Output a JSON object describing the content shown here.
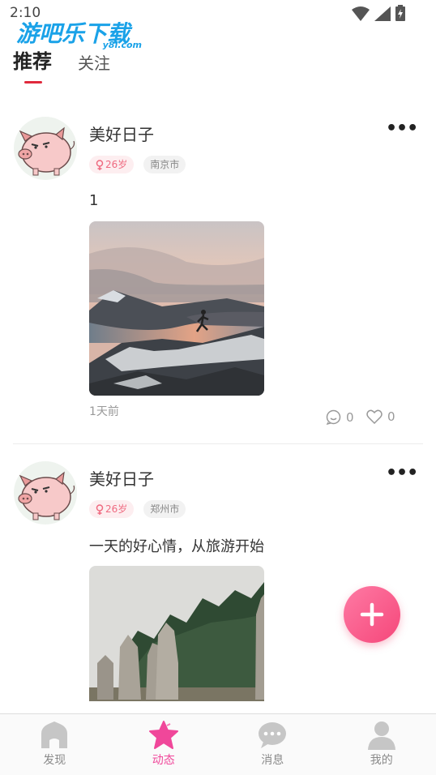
{
  "status_bar": {
    "time": "2:10"
  },
  "watermark": {
    "main": "游吧乐下载",
    "sub": "y8l.com"
  },
  "tabs": [
    {
      "label": "推荐"
    },
    {
      "label": "关注"
    }
  ],
  "posts": [
    {
      "username": "美好日子",
      "age": "26岁",
      "city": "南京市",
      "content": "1",
      "time": "1天前",
      "comments": "0",
      "likes": "0"
    },
    {
      "username": "美好日子",
      "age": "26岁",
      "city": "郑州市",
      "content": "一天的好心情，从旅游开始"
    }
  ],
  "bottom_nav": [
    {
      "label": "发现",
      "icon": "home-icon"
    },
    {
      "label": "动态",
      "icon": "star-icon"
    },
    {
      "label": "消息",
      "icon": "chat-icon"
    },
    {
      "label": "我的",
      "icon": "person-icon"
    }
  ],
  "colors": {
    "accent": "#f0479a",
    "tab_indicator": "#e0293c",
    "fab": "#f5477a"
  }
}
